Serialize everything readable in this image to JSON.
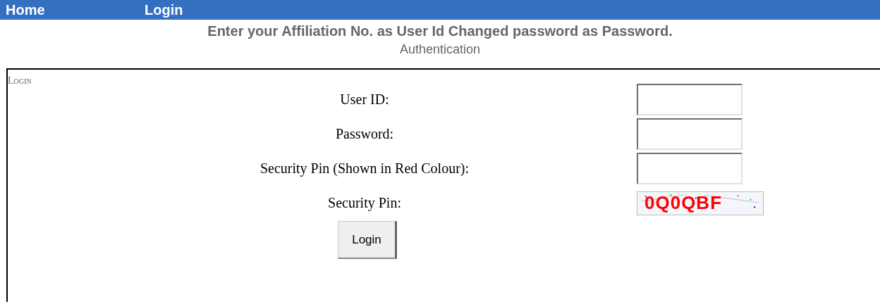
{
  "nav": [
    {
      "label": "Home"
    },
    {
      "label": "Login"
    }
  ],
  "instruction": "Enter your Affiliation No. as User Id Changed password as Password.",
  "section_title": "Authentication",
  "form": {
    "legend": "Login",
    "fields": [
      {
        "kind": "input",
        "label": "User ID:"
      },
      {
        "kind": "input",
        "label": "Password:"
      },
      {
        "kind": "input",
        "label": "Security Pin (Shown in Red Colour):"
      },
      {
        "kind": "captcha",
        "label": "Security Pin:",
        "captcha_text": "0Q0QBF"
      }
    ],
    "submit": "Login"
  }
}
